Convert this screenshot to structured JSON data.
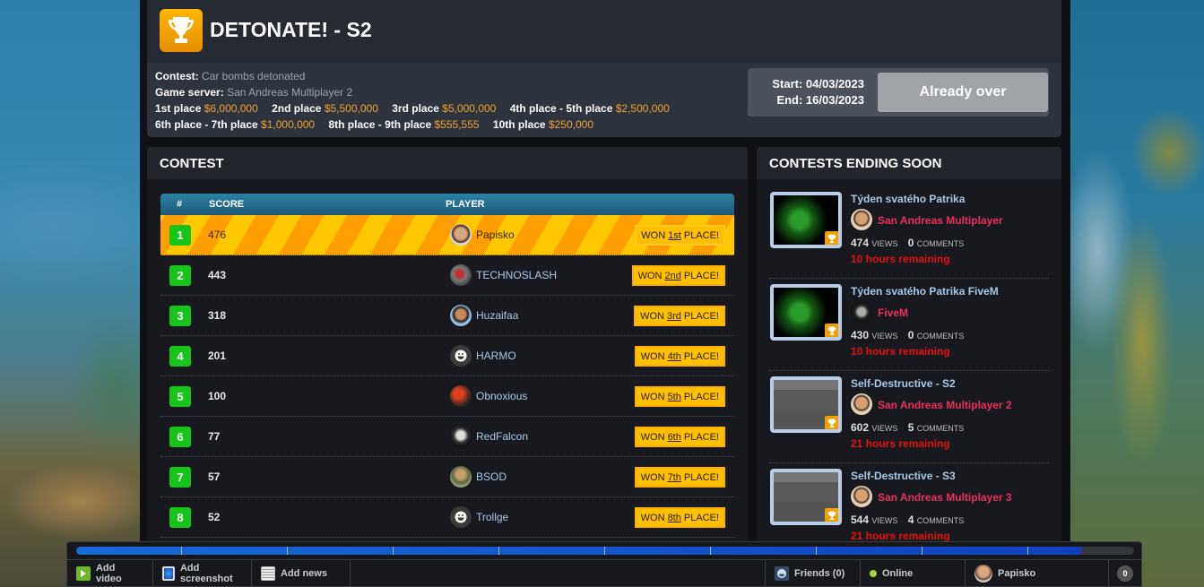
{
  "header": {
    "title": "DETONATE! - S2",
    "contest_label": "Contest:",
    "contest_value": "Car bombs detonated",
    "server_label": "Game server:",
    "server_value": "San Andreas Multiplayer 2",
    "prizes": [
      {
        "place": "1st place",
        "amount": "$6,000,000"
      },
      {
        "place": "2nd place",
        "amount": "$5,500,000"
      },
      {
        "place": "3rd place",
        "amount": "$5,000,000"
      },
      {
        "place": "4th place - 5th place",
        "amount": "$2,500,000"
      },
      {
        "place": "6th place - 7th place",
        "amount": "$1,000,000"
      },
      {
        "place": "8th place - 9th place",
        "amount": "$555,555"
      },
      {
        "place": "10th place",
        "amount": "$250,000"
      }
    ],
    "start": "Start: 04/03/2023",
    "end": "End: 16/03/2023",
    "status_button": "Already over"
  },
  "contest": {
    "heading": "CONTEST",
    "columns": {
      "rank": "#",
      "score": "SCORE",
      "player": "PLAYER"
    },
    "rows": [
      {
        "rank": "1",
        "score": "476",
        "player": "Papisko",
        "won_prefix": "WON",
        "won_place": "1st",
        "won_suffix": "PLACE!"
      },
      {
        "rank": "2",
        "score": "443",
        "player": "TECHNOSLASH",
        "won_prefix": "WON",
        "won_place": "2nd",
        "won_suffix": "PLACE!"
      },
      {
        "rank": "3",
        "score": "318",
        "player": "Huzaifaa",
        "won_prefix": "WON",
        "won_place": "3rd",
        "won_suffix": "PLACE!"
      },
      {
        "rank": "4",
        "score": "201",
        "player": "HARMO",
        "won_prefix": "WON",
        "won_place": "4th",
        "won_suffix": "PLACE!"
      },
      {
        "rank": "5",
        "score": "100",
        "player": "Obnoxious",
        "won_prefix": "WON",
        "won_place": "5th",
        "won_suffix": "PLACE!"
      },
      {
        "rank": "6",
        "score": "77",
        "player": "RedFalcon",
        "won_prefix": "WON",
        "won_place": "6th",
        "won_suffix": "PLACE!"
      },
      {
        "rank": "7",
        "score": "57",
        "player": "BSOD",
        "won_prefix": "WON",
        "won_place": "7th",
        "won_suffix": "PLACE!"
      },
      {
        "rank": "8",
        "score": "52",
        "player": "Trollge",
        "won_prefix": "WON",
        "won_place": "8th",
        "won_suffix": "PLACE!"
      }
    ]
  },
  "ending_soon": {
    "heading": "CONTESTS ENDING SOON",
    "items": [
      {
        "title": "Týden svatého Patrika",
        "server": "San Andreas Multiplayer",
        "views": "474",
        "views_label": "VIEWS",
        "comments": "0",
        "comments_label": "COMMENTS",
        "remaining": "10 hours remaining"
      },
      {
        "title": "Týden svatého Patrika FiveM",
        "server": "FiveM",
        "views": "430",
        "views_label": "VIEWS",
        "comments": "0",
        "comments_label": "COMMENTS",
        "remaining": "10 hours remaining"
      },
      {
        "title": "Self-Destructive - S2",
        "server": "San Andreas Multiplayer 2",
        "views": "602",
        "views_label": "VIEWS",
        "comments": "5",
        "comments_label": "COMMENTS",
        "remaining": "21 hours remaining"
      },
      {
        "title": "Self-Destructive - S3",
        "server": "San Andreas Multiplayer 3",
        "views": "544",
        "views_label": "VIEWS",
        "comments": "4",
        "comments_label": "COMMENTS",
        "remaining": "21 hours remaining"
      }
    ]
  },
  "bottom_bar": {
    "progress": 0.95,
    "add_video": "Add video",
    "add_screenshot": "Add screenshot",
    "add_news": "Add news",
    "friends": "Friends (0)",
    "status": "Online",
    "user": "Papisko",
    "notifications": "0"
  },
  "colors": {
    "accent_orange": "#f0a030",
    "rank_green": "#16c41a",
    "won_badge": "#ffc000",
    "server_link": "#e8305a",
    "remaining_red": "#e01010",
    "player_link": "#a9c8e8"
  }
}
